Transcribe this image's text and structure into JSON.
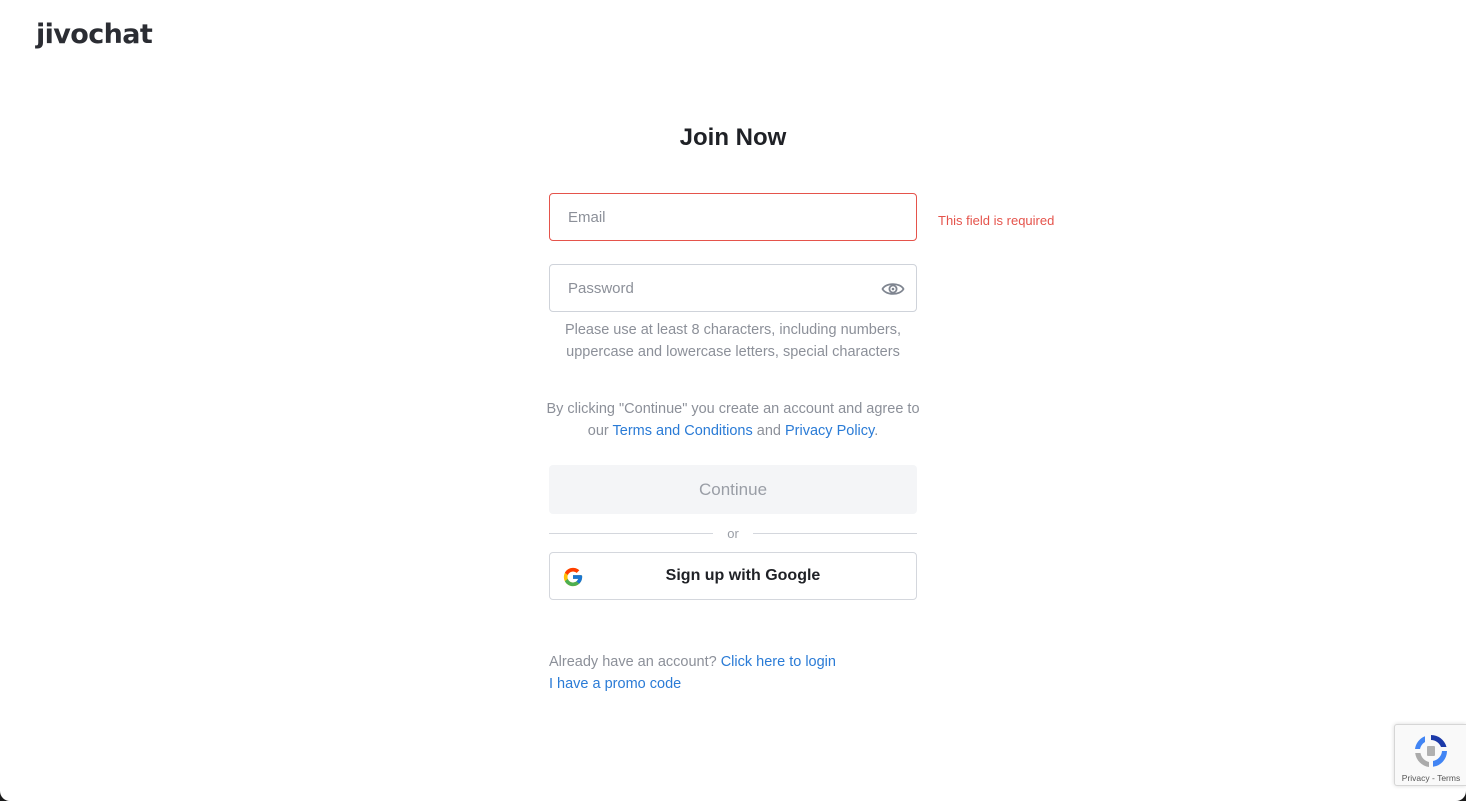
{
  "brand": {
    "logo_text": "jivochat",
    "accent_color": "#5cb85c"
  },
  "form": {
    "title": "Join Now",
    "email": {
      "placeholder": "Email",
      "value": "",
      "error": "This field is required"
    },
    "password": {
      "placeholder": "Password",
      "value": "",
      "toggle_icon": "eye-icon",
      "hint": "Please use at least 8 characters, including numbers, uppercase and lowercase letters, special characters"
    },
    "consent": {
      "prefix": "By clicking \"Continue\" you create an account and agree to our ",
      "terms_link": "Terms and Conditions",
      "joiner": " and ",
      "privacy_link": "Privacy Policy",
      "suffix": "."
    },
    "continue_label": "Continue",
    "divider_label": "or",
    "google_label": "Sign up with Google",
    "google_icon": "google-icon"
  },
  "footer": {
    "login_prompt": "Already have an account? ",
    "login_link": "Click here to login",
    "promo_link": "I have a promo code"
  },
  "recaptcha": {
    "privacy": "Privacy",
    "separator": " - ",
    "terms": "Terms"
  },
  "colors": {
    "error": "#e5534b",
    "link": "#2a7bd6",
    "muted_text": "#8c9099"
  }
}
